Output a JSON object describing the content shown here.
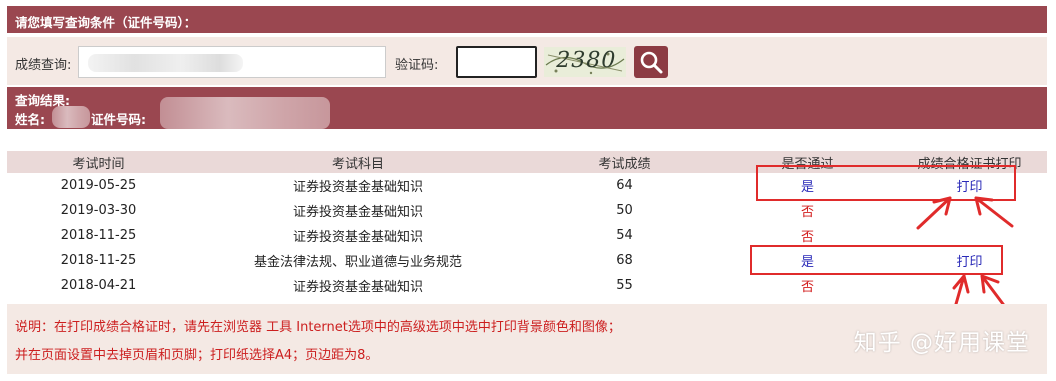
{
  "header": {
    "title": "请您填写查询条件（证件号码）："
  },
  "query": {
    "score_label": "成绩查询:",
    "score_placeholder": "",
    "captcha_label": "验证码:",
    "captcha_value": "",
    "captcha_image_text": "2380"
  },
  "result_header": {
    "title": "查询结果:",
    "name_label": "姓名:",
    "id_label": "证件号码:"
  },
  "table": {
    "headers": [
      "考试时间",
      "考试科目",
      "考试成绩",
      "是否通过",
      "成绩合格证书打印"
    ],
    "rows": [
      {
        "date": "2019-05-25",
        "subject": "证券投资基金基础知识",
        "score": "64",
        "pass": "是",
        "print": "打印"
      },
      {
        "date": "2019-03-30",
        "subject": "证券投资基金基础知识",
        "score": "50",
        "pass": "否",
        "print": ""
      },
      {
        "date": "2018-11-25",
        "subject": "证券投资基金基础知识",
        "score": "54",
        "pass": "否",
        "print": ""
      },
      {
        "date": "2018-11-25",
        "subject": "基金法律法规、职业道德与业务规范",
        "score": "68",
        "pass": "是",
        "print": "打印"
      },
      {
        "date": "2018-04-21",
        "subject": "证券投资基金基础知识",
        "score": "55",
        "pass": "否",
        "print": ""
      }
    ]
  },
  "notes": {
    "line1": "说明：在打印成绩合格证时，请先在浏览器 工具 Internet选项中的高级选项中选中打印背景颜色和图像；",
    "line2": "并在页面设置中去掉页眉和页脚；打印纸选择A4；页边距为8。"
  },
  "watermark": "知乎 @好用课堂",
  "colors": {
    "band": "#9a4750",
    "panel": "#f4e9e4",
    "pass_yes": "#2a2ab8",
    "pass_no": "#d21c1c",
    "annotation": "#e02b2b"
  }
}
